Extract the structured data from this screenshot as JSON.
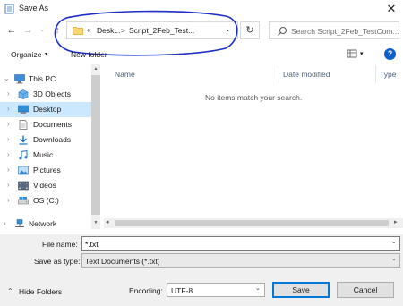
{
  "window": {
    "title": "Save As",
    "close_glyph": "✕"
  },
  "nav": {
    "back_glyph": "←",
    "forward_glyph": "→",
    "forward_dropdown_glyph": "⌄",
    "up_glyph": "↑",
    "refresh_glyph": "↻"
  },
  "address": {
    "overflow_chevrons": "«",
    "crumbs": [
      "Desk...",
      "Script_2Feb_Test..."
    ],
    "separator": ">",
    "dropdown_glyph": "⌄"
  },
  "search": {
    "placeholder": "Search Script_2Feb_TestCom..."
  },
  "toolbar": {
    "organize_label": "Organize",
    "organize_dropdown": "▾",
    "new_folder_label": "New folder",
    "view_dropdown": "▾",
    "help_label": "?"
  },
  "sidebar": {
    "items": [
      {
        "label": "This PC",
        "icon": "computer-icon"
      },
      {
        "label": "3D Objects",
        "icon": "cube-icon"
      },
      {
        "label": "Desktop",
        "icon": "desktop-icon"
      },
      {
        "label": "Documents",
        "icon": "documents-icon"
      },
      {
        "label": "Downloads",
        "icon": "download-icon"
      },
      {
        "label": "Music",
        "icon": "music-icon"
      },
      {
        "label": "Pictures",
        "icon": "pictures-icon"
      },
      {
        "label": "Videos",
        "icon": "videos-icon"
      },
      {
        "label": "OS (C:)",
        "icon": "drive-icon"
      },
      {
        "label": "Network",
        "icon": "network-icon"
      }
    ],
    "selected": "Desktop",
    "chevron": "›",
    "expanded_chevron": "⌄"
  },
  "filelist": {
    "columns": [
      "Name",
      "Date modified",
      "Type"
    ],
    "empty_message": "No items match your search."
  },
  "scroll": {
    "up": "▲",
    "down": "▼",
    "left": "◂",
    "right": "▸"
  },
  "form": {
    "filename_label": "File name:",
    "filename_value": "*.txt",
    "savetype_label": "Save as type:",
    "savetype_value": "Text Documents (*.txt)",
    "dropdown_glyph": "⌄",
    "encoding_label": "Encoding:",
    "encoding_value": "UTF-8"
  },
  "footer": {
    "hide_folders_label": "Hide Folders",
    "hide_folders_chevron": "⌃",
    "save_label": "Save",
    "cancel_label": "Cancel"
  },
  "colors": {
    "accent": "#0078d7",
    "selection": "#cce8ff",
    "annotation": "#1e2fc8",
    "help": "#0c5fd0"
  }
}
